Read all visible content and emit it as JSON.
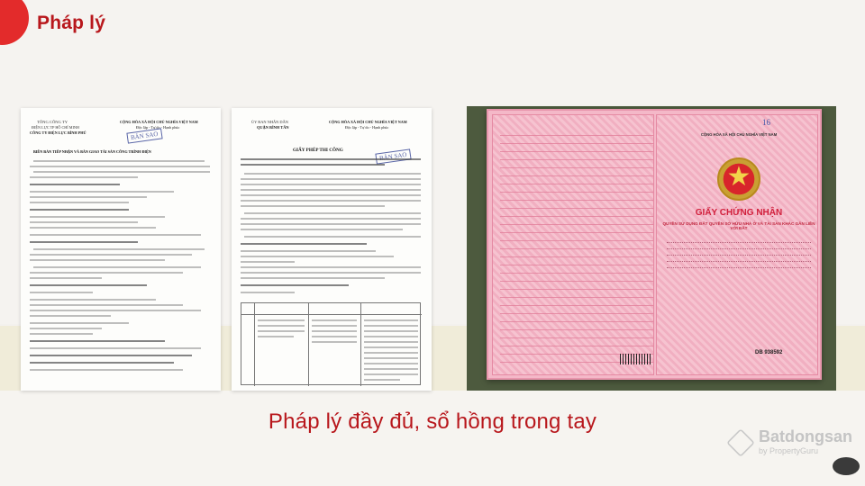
{
  "header": {
    "title": "Pháp lý"
  },
  "footer": {
    "caption": "Pháp lý đầy đủ, sổ hồng trong tay"
  },
  "doc1": {
    "org_line1": "TỔNG CÔNG TY",
    "org_line2": "ĐIỆN LỰC TP HỒ CHÍ MINH",
    "org_line3": "CÔNG TY ĐIỆN LỰC BÌNH PHÚ",
    "nation": "CỘNG HÒA XÃ HỘI CHỦ NGHĨA VIỆT NAM",
    "motto": "Độc lập - Tự do - Hạnh phúc",
    "stamp": "BẢN SAO",
    "heading": "BIÊN BẢN TIẾP NHẬN VÀ BÀN GIAO TÀI SẢN CÔNG TRÌNH ĐIỆN"
  },
  "doc2": {
    "org_line1": "ỦY BAN NHÂN DÂN",
    "org_line2": "QUẬN BÌNH TÂN",
    "nation": "CỘNG HÒA XÃ HỘI CHỦ NGHĨA VIỆT NAM",
    "motto": "Độc lập - Tự do - Hạnh phúc",
    "stamp": "BẢN SAO",
    "heading": "GIẤY PHÉP THI CÔNG"
  },
  "certificate": {
    "nation": "CỘNG HÒA XÃ HỘI CHỦ NGHĨA VIỆT NAM",
    "title": "GIẤY CHỨNG NHẬN",
    "subtitle": "QUYỀN SỬ DỤNG ĐẤT QUYỀN SỞ HỮU NHÀ Ở VÀ TÀI SẢN KHÁC GẮN LIỀN VỚI ĐẤT",
    "number_tag": "16",
    "serial": "DB 938592"
  },
  "watermark": {
    "name": "Batdongsan",
    "by": "by PropertyGuru"
  },
  "colors": {
    "accent": "#b8171c",
    "band": "#f0ecd9",
    "certificate_pink": "#f4b8c8",
    "certificate_bg": "#4d5a3e"
  }
}
